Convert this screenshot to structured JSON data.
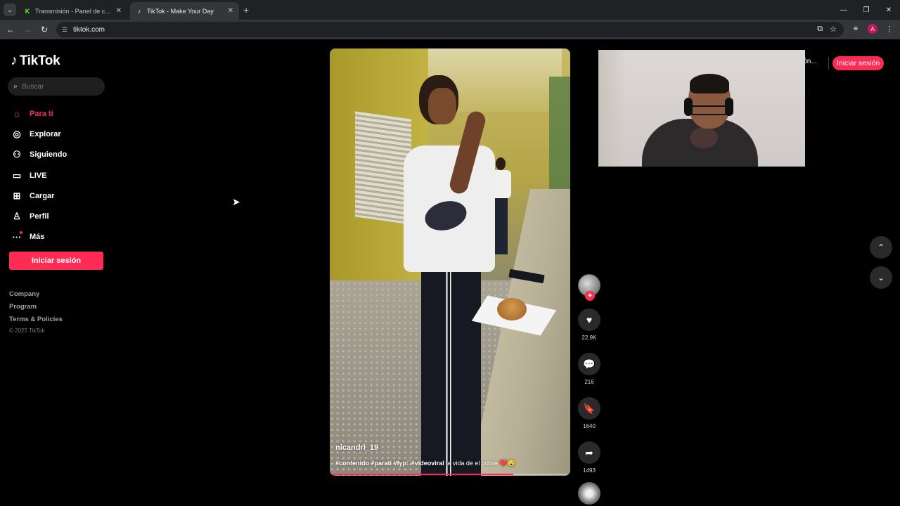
{
  "browser": {
    "tabs": [
      {
        "title": "Transmisión - Panel de control",
        "favicon": "K",
        "favicon_color": "#53fc18",
        "active": false
      },
      {
        "title": "TikTok - Make Your Day",
        "favicon": "♪",
        "favicon_color": "#ffffff",
        "active": true
      }
    ],
    "new_tab": "+",
    "url": "tiktok.com",
    "profile_initial": "A",
    "window_controls": {
      "minimize": "—",
      "restore": "❐",
      "close": "✕"
    }
  },
  "sidebar": {
    "logo": "TikTok",
    "search_placeholder": "Buscar",
    "items": [
      {
        "label": "Para ti",
        "icon": "home-icon",
        "glyph": "⌂",
        "active": true
      },
      {
        "label": "Explorar",
        "icon": "compass-icon",
        "glyph": "◎",
        "active": false
      },
      {
        "label": "Siguiendo",
        "icon": "user-follow-icon",
        "glyph": "⚇",
        "active": false
      },
      {
        "label": "LIVE",
        "icon": "live-tv-icon",
        "glyph": "▭",
        "active": false
      },
      {
        "label": "Cargar",
        "icon": "upload-plus-icon",
        "glyph": "⊞",
        "active": false
      },
      {
        "label": "Perfil",
        "icon": "profile-icon",
        "glyph": "♙",
        "active": false
      },
      {
        "label": "Más",
        "icon": "more-icon",
        "glyph": "···",
        "active": false
      }
    ],
    "login_label": "Iniciar sesión",
    "footer_links": [
      "Company",
      "Program",
      "Terms & Policies"
    ],
    "copyright": "© 2025 TikTok"
  },
  "video": {
    "username": "nicandri_19",
    "hashtags": "#contenido #parati #fyp゚#videoviral",
    "caption_text": "la vida de el pobre",
    "caption_emoji": "❤️😮",
    "progress": 0.77
  },
  "actions": {
    "follow": "+",
    "likes": "22.9K",
    "comments": "216",
    "saves": "1640",
    "shares": "1493"
  },
  "header": {
    "partial_text": "ión...",
    "login_label": "Iniciar sesión"
  },
  "scroll": {
    "up": "⌃",
    "down": "⌄"
  },
  "colors": {
    "accent": "#fe2c55",
    "background": "#000000",
    "chrome_dark": "#202124",
    "chrome_mid": "#35363a"
  }
}
